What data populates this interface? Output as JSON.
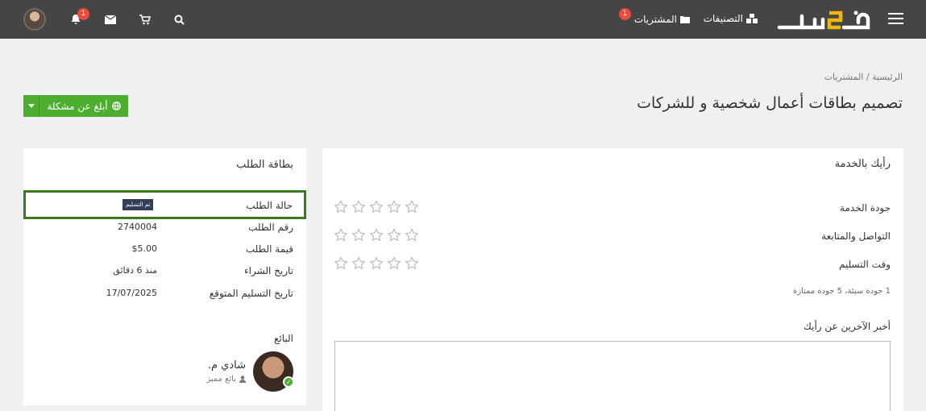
{
  "header": {
    "nav": {
      "categories_label": "التصنيفات",
      "purchases_label": "المشتريات",
      "purchases_badge": "1"
    },
    "notifications_badge": "1",
    "icons": [
      "menu-icon",
      "categories-icon",
      "purchases-icon",
      "search-icon",
      "cart-icon",
      "mail-icon",
      "bell-icon",
      "avatar"
    ],
    "logo_text": "خمسات"
  },
  "breadcrumb": {
    "home": "الرئيسية",
    "separator": "/",
    "current": "المشتريات"
  },
  "page": {
    "title": "تصميم بطاقات أعمال شخصية و للشركات",
    "report_button": "أبلغ عن مشكلة"
  },
  "review": {
    "title": "رأيك بالخدمة",
    "rows": [
      {
        "label": "جودة الخدمة",
        "stars": 5
      },
      {
        "label": "التواصل والمتابعة",
        "stars": 5
      },
      {
        "label": "وقت التسليم",
        "stars": 5
      }
    ],
    "hint": "1 جودة سيئة، 5 جودة ممتازة",
    "tell_others": "أخبر الآخرين عن رأيك",
    "comment_value": ""
  },
  "order_card": {
    "title": "بطاقة الطلب",
    "status_label": "حالة الطلب",
    "status_value": "تم التسليم",
    "rows": [
      {
        "label": "رقم الطلب",
        "value": "2740004"
      },
      {
        "label": "قيمة الطلب",
        "value": "$5.00"
      },
      {
        "label": "تاريخ الشراء",
        "value": "منذ 6 دقائق"
      },
      {
        "label": "تاريخ التسليم المتوقع",
        "value": "17/07/2025"
      }
    ],
    "seller_title": "البائع",
    "seller_name": "شادي م.",
    "seller_badge": "بائع مميز"
  },
  "colors": {
    "topbar": "#454545",
    "accent_green": "#4cae2f",
    "badge_red": "#e74c3c",
    "status_border": "#3b7a1e",
    "status_badge": "#333f5a"
  }
}
